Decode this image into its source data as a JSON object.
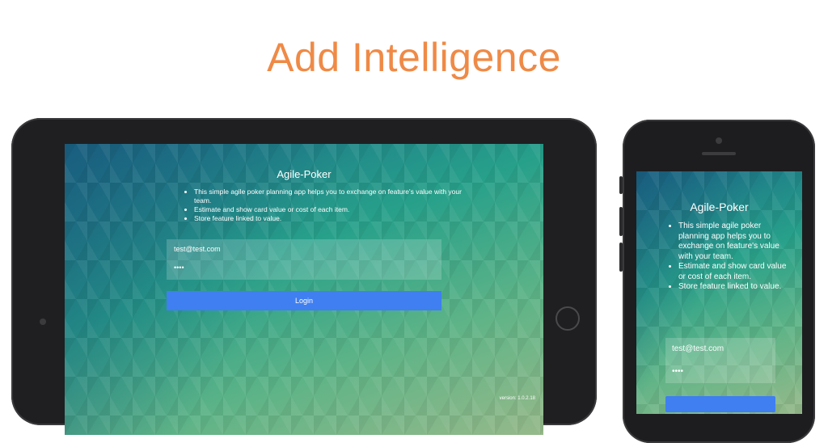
{
  "headline": "Add Intelligence",
  "tablet": {
    "title": "Agile-Poker",
    "bullets": [
      "This simple agile poker planning app helps you to exchange on feature's value with your team.",
      "Estimate and show card value or cost of each item.",
      "Store feature linked to value."
    ],
    "email_value": "test@test.com",
    "password_value": "••••",
    "login_label": "Login",
    "version": "version: 1.0.2.18"
  },
  "phone": {
    "title": "Agile-Poker",
    "bullets": [
      "This simple agile poker planning app helps you to exchange on feature's value with your team.",
      "Estimate and show card value or cost of each item.",
      "Store feature linked to value."
    ],
    "email_value": "test@test.com",
    "password_value": "••••"
  },
  "colors": {
    "headline": "#ef8a46",
    "button": "#3f7ff1",
    "device_frame": "#1f1f21"
  }
}
